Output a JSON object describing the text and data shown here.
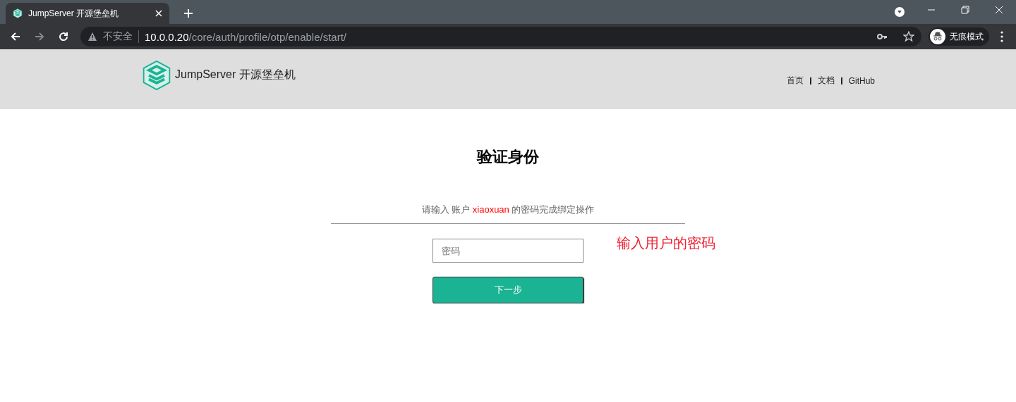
{
  "browser": {
    "tab": {
      "title": "JumpServer 开源堡垒机",
      "selected": true
    },
    "security_label": "不安全",
    "url_host": "10.0.0.20",
    "url_path": "/core/auth/profile/otp/enable/start/",
    "profile_label": "无痕模式"
  },
  "header": {
    "brand": "JumpServer 开源堡垒机",
    "nav": [
      "首页",
      "文档",
      "GitHub"
    ]
  },
  "form": {
    "title": "验证身份",
    "instruction_prefix": "请输入 账户",
    "account": "xiaoxuan",
    "instruction_suffix": "的密码完成绑定操作",
    "password": {
      "placeholder": "密码"
    },
    "submit": "下一步"
  },
  "annotation": "输入用户的密码"
}
